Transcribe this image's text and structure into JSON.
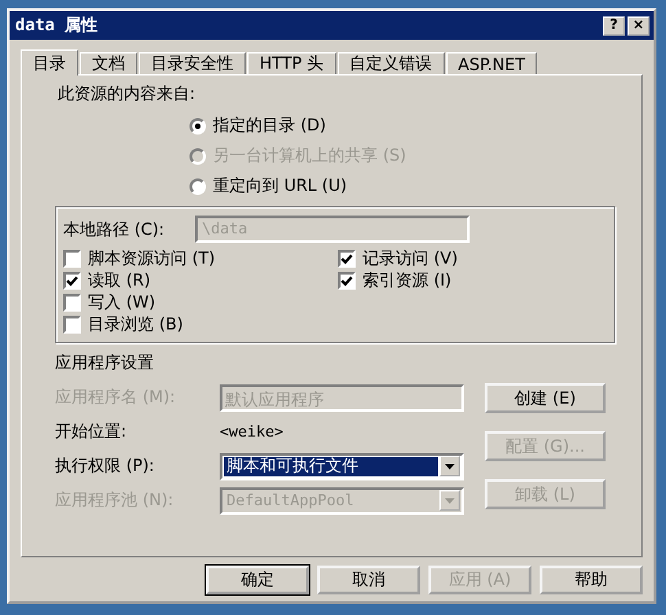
{
  "window": {
    "title": "data 属性",
    "title_buttons": [
      "?",
      "×"
    ]
  },
  "tabs": [
    {
      "label": "目录",
      "selected": true
    },
    {
      "label": "文档",
      "selected": false
    },
    {
      "label": "目录安全性",
      "selected": false
    },
    {
      "label": "HTTP 头",
      "selected": false
    },
    {
      "label": "自定义错误",
      "selected": false
    },
    {
      "label": "ASP.NET",
      "selected": false
    }
  ],
  "content_source": {
    "label": "此资源的内容来自:",
    "options": [
      {
        "label": "指定的目录 (D)",
        "selected": true,
        "disabled": false
      },
      {
        "label": "另一台计算机上的共享 (S)",
        "selected": false,
        "disabled": true
      },
      {
        "label": "重定向到 URL (U)",
        "selected": false,
        "disabled": false
      }
    ]
  },
  "local_path": {
    "label": "本地路径 (C):",
    "value": "\\data",
    "disabled": true
  },
  "permissions_left": [
    {
      "label": "脚本资源访问 (T)",
      "checked": false
    },
    {
      "label": "读取 (R)",
      "checked": true
    },
    {
      "label": "写入 (W)",
      "checked": false
    },
    {
      "label": "目录浏览 (B)",
      "checked": false
    }
  ],
  "permissions_right": [
    {
      "label": "记录访问 (V)",
      "checked": true
    },
    {
      "label": "索引资源 (I)",
      "checked": true
    }
  ],
  "app_settings": {
    "heading": "应用程序设置",
    "rows": [
      {
        "kind": "field",
        "label": "应用程序名 (M):",
        "value": "默认应用程序",
        "disabled": true
      },
      {
        "kind": "text",
        "label": "开始位置:",
        "value": "<weike>",
        "disabled": false
      },
      {
        "kind": "select",
        "label": "执行权限 (P):",
        "value": "脚本和可执行文件",
        "disabled": false
      },
      {
        "kind": "select",
        "label": "应用程序池 (N):",
        "value": "DefaultAppPool",
        "disabled": true
      }
    ],
    "buttons": [
      {
        "label": "创建 (E)",
        "disabled": false
      },
      {
        "label": "配置 (G)...",
        "disabled": true
      },
      {
        "label": "卸载 (L)",
        "disabled": true
      }
    ]
  },
  "dialog_buttons": [
    {
      "label": "确定",
      "disabled": false,
      "default": true
    },
    {
      "label": "取消",
      "disabled": false,
      "default": false
    },
    {
      "label": "应用 (A)",
      "disabled": true,
      "default": false
    },
    {
      "label": "帮助",
      "disabled": false,
      "default": false
    }
  ]
}
